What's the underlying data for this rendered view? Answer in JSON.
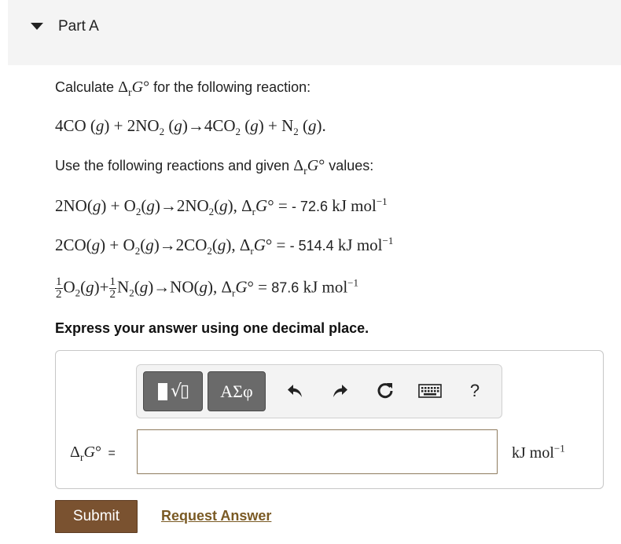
{
  "part": {
    "title": "Part A"
  },
  "question": {
    "prompt_before": "Calculate",
    "prompt_after": "for the following reaction:",
    "main_reaction": "4CO (g) + 2NO2 (g)→4CO2 (g) + N2 (g).",
    "given_intro_before": "Use the following reactions and given",
    "given_intro_after": "values:",
    "reactions": [
      {
        "equation": "2NO(g) + O2(g)→2NO2(g), ΔrG° =",
        "value": "- 72.6",
        "unit": "kJ mol⁻¹"
      },
      {
        "equation": "2CO(g) + O2(g)→2CO2(g), ΔrG° =",
        "value": "- 514.4",
        "unit": "kJ mol⁻¹"
      },
      {
        "equation": "½O2(g)+½N2(g)→NO(g), ΔrG° =",
        "value": "87.6",
        "unit": "kJ mol⁻¹"
      }
    ],
    "instruction": "Express your answer using one decimal place."
  },
  "toolbar": {
    "templates_icon": "templates-icon",
    "greek_label": "ΑΣφ",
    "undo_icon": "undo-icon",
    "redo_icon": "redo-icon",
    "reset_icon": "reset-icon",
    "keyboard_icon": "keyboard-icon",
    "help_label": "?"
  },
  "answer": {
    "lhs_suffix": "=",
    "value": "",
    "unit": "kJ mol⁻¹"
  },
  "actions": {
    "submit_label": "Submit",
    "request_label": "Request Answer"
  },
  "colors": {
    "submit_bg": "#7a5230",
    "link": "#7a5a24",
    "input_border": "#8e7b5e"
  }
}
